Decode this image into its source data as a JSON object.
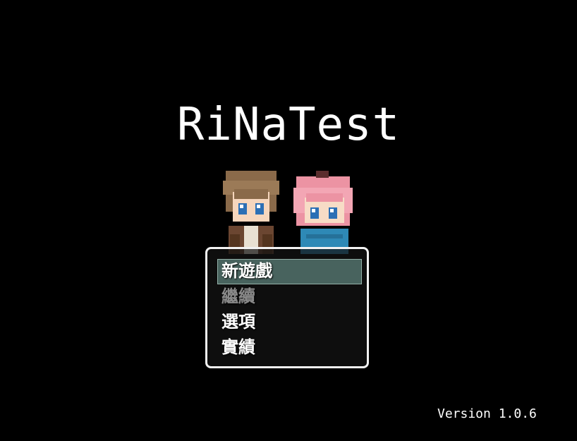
{
  "game": {
    "title": "RiNaTest",
    "version": "Version 1.0.6"
  },
  "menu": {
    "items": [
      {
        "label": "新遊戲",
        "enabled": true,
        "selected": true
      },
      {
        "label": "繼續",
        "enabled": false,
        "selected": false
      },
      {
        "label": "選項",
        "enabled": true,
        "selected": false
      },
      {
        "label": "實績",
        "enabled": true,
        "selected": false
      }
    ]
  }
}
